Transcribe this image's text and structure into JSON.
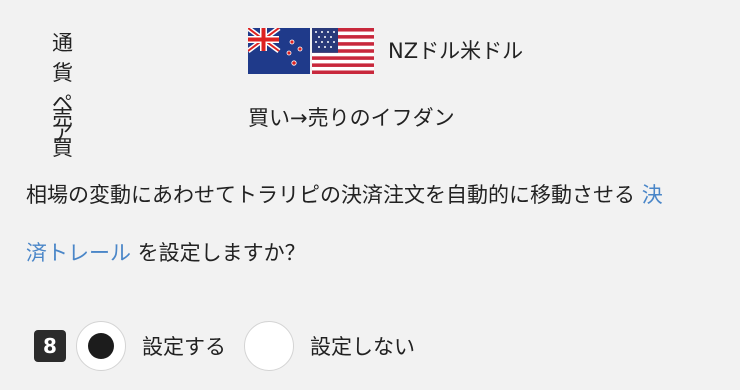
{
  "order": {
    "pair_label": "通貨ペア",
    "pair_value": "NZドル米ドル",
    "trade_label": "売買",
    "trade_value": "買い→売りのイフダン"
  },
  "question": {
    "line1_text": "相場の変動にあわせてトラリピの決済注文を自動的に移動させる ",
    "line1_link": "決",
    "line2_link": "済トレール",
    "line2_text": " を設定しますか？"
  },
  "options": {
    "step_badge": "8",
    "option_on_label": "設定する",
    "option_off_label": "設定しない",
    "selected": "option_on"
  },
  "icons": {
    "flag_left": "new-zealand-flag-icon",
    "flag_right": "usa-flag-icon"
  },
  "colors": {
    "link": "#4a86c8",
    "background": "#f2f2f2",
    "badge": "#2b2b2b"
  }
}
